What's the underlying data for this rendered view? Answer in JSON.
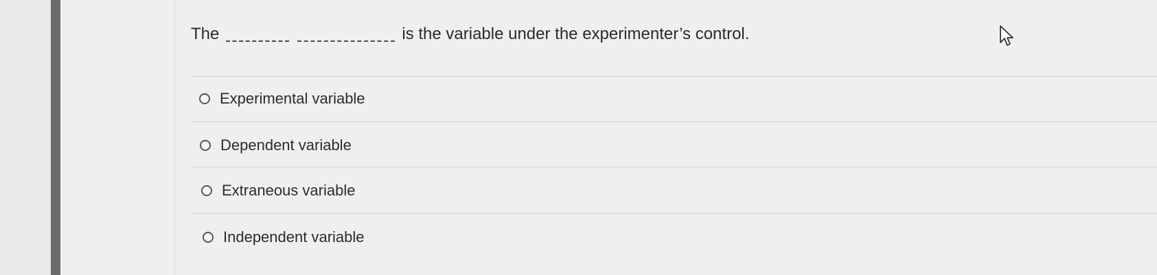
{
  "question": {
    "prefix": "The",
    "suffix": "is the variable under the experimenter’s control."
  },
  "options": [
    {
      "label": "Experimental variable"
    },
    {
      "label": "Dependent variable"
    },
    {
      "label": "Extraneous variable"
    },
    {
      "label": "Independent variable"
    }
  ],
  "colors": {
    "background": "#eeeff0",
    "left_bar": "#6a6b6c",
    "text": "#2b2b2b",
    "divider": "#cdd0d2"
  },
  "icons": {
    "cursor": "mouse-pointer-icon",
    "radio": "radio-button-icon"
  }
}
